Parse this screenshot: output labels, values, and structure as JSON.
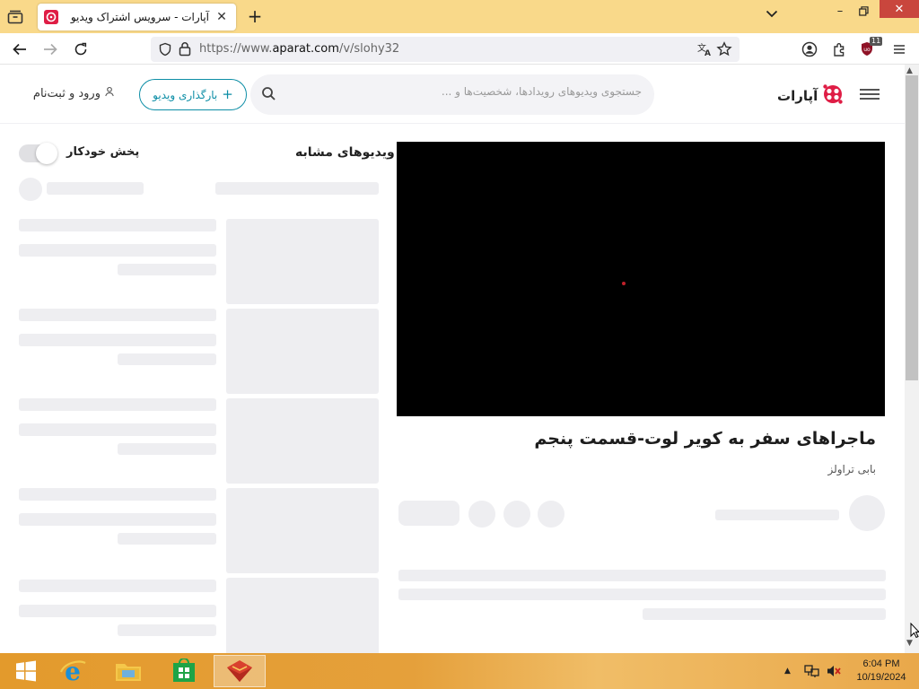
{
  "browser": {
    "tab_title": "آپارات - سرویس اشتراک ویدیو",
    "url_prefix": "https://www.",
    "url_host": "aparat.com",
    "url_path": "/v/slohy32",
    "extension_badge": "11"
  },
  "header": {
    "logo_text": "آپارات",
    "search_placeholder": "جستجوی ویدیوهای رویدادها، شخصیت‌ها و ...",
    "upload_label": "بارگذاری ویدیو",
    "login_label": "ورود و ثبت‌نام"
  },
  "sidebar": {
    "title": "ویدیوهای مشابه",
    "autoplay_label": "پخش خودکار"
  },
  "video": {
    "title": "ماجراهای سفر به کویر لوت-قسمت پنجم",
    "channel": "بابی تراولز"
  },
  "taskbar": {
    "time": "6:04 PM",
    "date": "10/19/2024"
  },
  "colors": {
    "tabstrip": "#f9d98a",
    "accent": "#0d8ea6",
    "brand": "#df1d45",
    "taskbar": "#e39a2c"
  }
}
